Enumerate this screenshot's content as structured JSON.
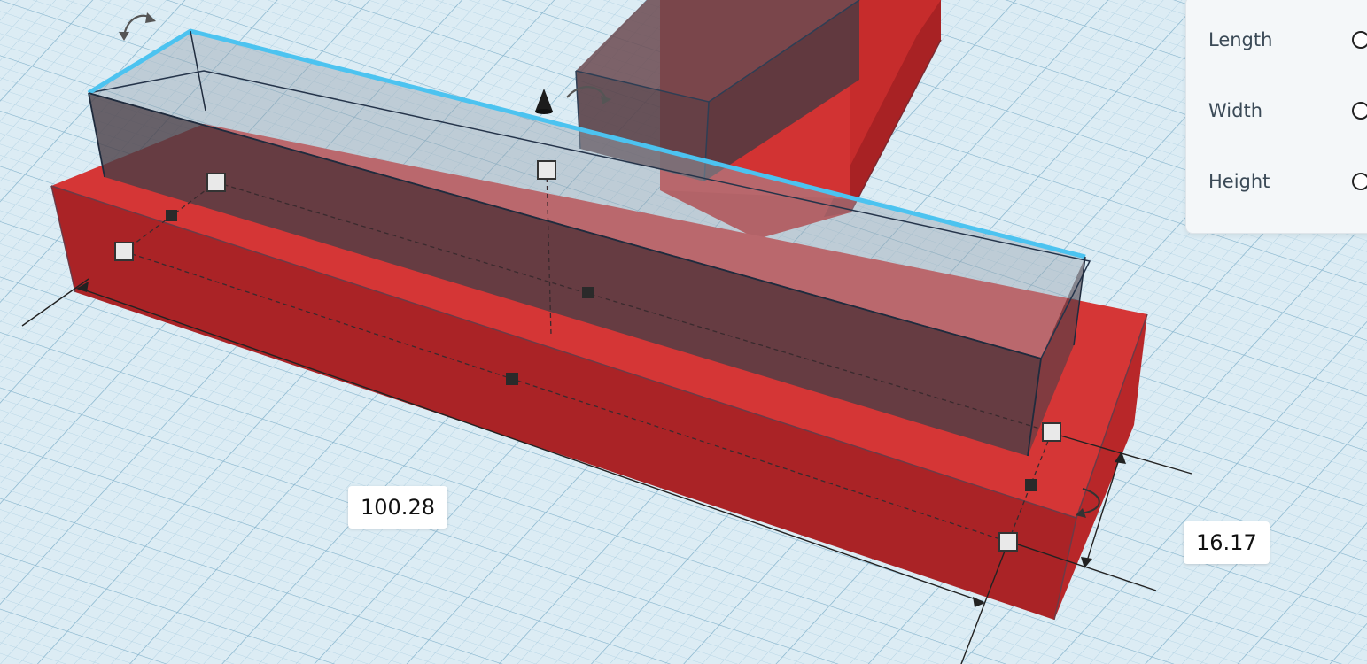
{
  "viewport": {
    "colors": {
      "grid_background": "#dcecf4",
      "grid_line": "#9fc4d8",
      "shape_red": "#c8282a",
      "selection_outline": "#4cc3f0",
      "hole_fill": "#4d4348"
    }
  },
  "dimensions": {
    "length_value": "100.28",
    "height_value": "16.17"
  },
  "properties_panel": {
    "rows": [
      {
        "label": "Length"
      },
      {
        "label": "Width"
      },
      {
        "label": "Height"
      }
    ]
  },
  "icons": {
    "rotate": "rotate-arrow-icon",
    "lift": "cone-arrow-icon",
    "handle": "square-handle-icon"
  }
}
